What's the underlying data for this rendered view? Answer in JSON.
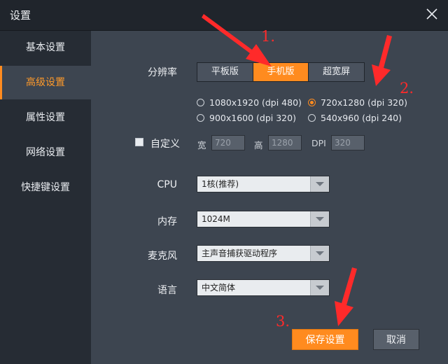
{
  "window": {
    "title": "设置"
  },
  "sidebar": {
    "items": [
      {
        "label": "基本设置",
        "active": false
      },
      {
        "label": "高级设置",
        "active": true
      },
      {
        "label": "属性设置",
        "active": false
      },
      {
        "label": "网络设置",
        "active": false
      },
      {
        "label": "快捷键设置",
        "active": false
      }
    ]
  },
  "resolution": {
    "label": "分辨率",
    "modes": [
      {
        "label": "平板版",
        "selected": false
      },
      {
        "label": "手机版",
        "selected": true
      },
      {
        "label": "超宽屏",
        "selected": false
      }
    ],
    "options": [
      {
        "label": "1080x1920 (dpi 480)",
        "checked": false
      },
      {
        "label": "720x1280 (dpi 320)",
        "checked": true
      },
      {
        "label": "900x1600 (dpi 320)",
        "checked": false
      },
      {
        "label": "540x960 (dpi 240)",
        "checked": false
      }
    ],
    "custom": {
      "label": "自定义",
      "checked": false,
      "width_label": "宽",
      "width_value": "720",
      "height_label": "高",
      "height_value": "1280",
      "dpi_label": "DPI",
      "dpi_value": "320"
    }
  },
  "cpu": {
    "label": "CPU",
    "value": "1核(推荐)"
  },
  "memory": {
    "label": "内存",
    "value": "1024M"
  },
  "microphone": {
    "label": "麦克风",
    "value": "主声音捕获驱动程序"
  },
  "language": {
    "label": "语言",
    "value": "中文简体"
  },
  "buttons": {
    "save": "保存设置",
    "cancel": "取消"
  },
  "annotations": {
    "step1": "1.",
    "step2": "2.",
    "step3": "3."
  },
  "colors": {
    "accent": "#ff8b1f",
    "annotation": "#ff2a2a",
    "panel_bg": "#3d4550",
    "sidebar_bg": "#262c34"
  }
}
